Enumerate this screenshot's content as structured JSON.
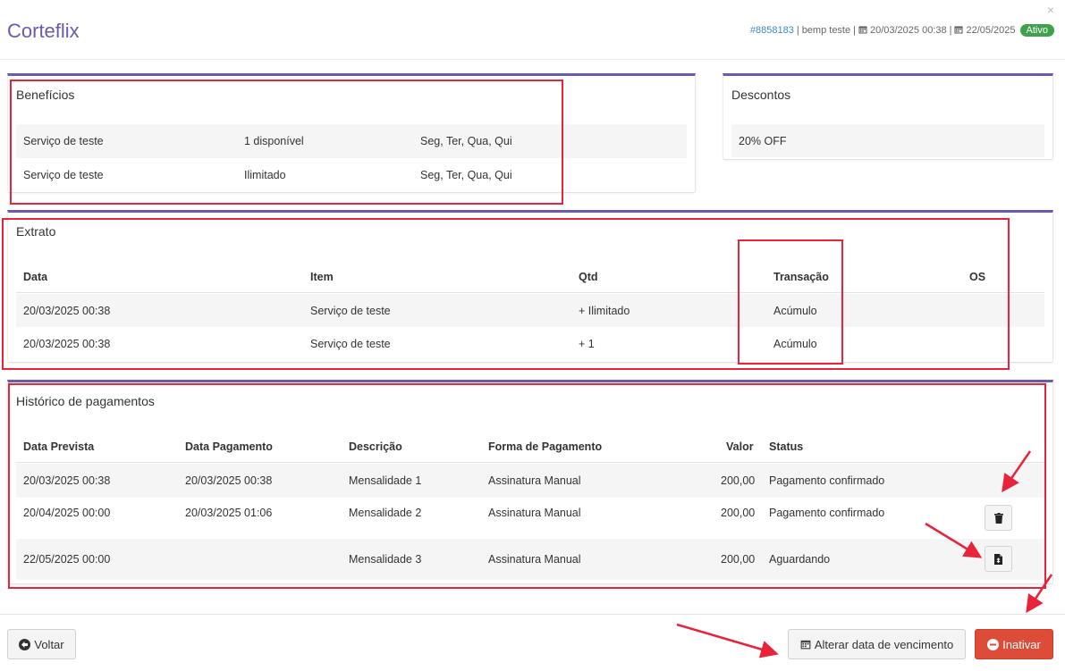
{
  "header": {
    "title": "Corteflix",
    "close": "×",
    "id": "#8858183",
    "sep1": "|",
    "customer": "bemp teste",
    "sep2": "|",
    "start_date": "20/03/2025 00:38",
    "sep3": "|",
    "end_date": "22/05/2025",
    "status": "Ativo"
  },
  "beneficios": {
    "title": "Benefícios",
    "rows": [
      {
        "servico": "Serviço de teste",
        "qtd": "1 disponível",
        "dias": "Seg, Ter, Qua, Qui"
      },
      {
        "servico": "Serviço de teste",
        "qtd": "Ilimitado",
        "dias": "Seg, Ter, Qua, Qui"
      }
    ]
  },
  "descontos": {
    "title": "Descontos",
    "rows": [
      {
        "valor": "20% OFF"
      }
    ]
  },
  "extrato": {
    "title": "Extrato",
    "columns": [
      "Data",
      "Item",
      "Qtd",
      "Transação",
      "OS"
    ],
    "rows": [
      {
        "data": "20/03/2025 00:38",
        "item": "Serviço de teste",
        "qtd": "+ Ilimitado",
        "transacao": "Acúmulo",
        "os": ""
      },
      {
        "data": "20/03/2025 00:38",
        "item": "Serviço de teste",
        "qtd": "+ 1",
        "transacao": "Acúmulo",
        "os": ""
      }
    ]
  },
  "historico": {
    "title": "Histórico de pagamentos",
    "columns": [
      "Data Prevista",
      "Data Pagamento",
      "Descrição",
      "Forma de Pagamento",
      "Valor",
      "Status"
    ],
    "rows": [
      {
        "prevista": "20/03/2025 00:38",
        "pagamento": "20/03/2025 00:38",
        "descricao": "Mensalidade 1",
        "forma": "Assinatura Manual",
        "valor": "200,00",
        "status": "Pagamento confirmado"
      },
      {
        "prevista": "20/04/2025 00:00",
        "pagamento": "20/03/2025 01:06",
        "descricao": "Mensalidade 2",
        "forma": "Assinatura Manual",
        "valor": "200,00",
        "status": "Pagamento confirmado"
      },
      {
        "prevista": "22/05/2025 00:00",
        "pagamento": "",
        "descricao": "Mensalidade 3",
        "forma": "Assinatura Manual",
        "valor": "200,00",
        "status": "Aguardando"
      }
    ]
  },
  "footer": {
    "voltar": "Voltar",
    "alterar": "Alterar data de vencimento",
    "inativar": "Inativar"
  },
  "colors": {
    "accent": "#6a5bb0",
    "link": "#3d8ec6",
    "success": "#3fa14b",
    "danger": "#dd4b39",
    "annotation": "#e8233a"
  },
  "icons": [
    "close-icon",
    "calendar-icon",
    "trash-icon",
    "invoice-icon",
    "arrow-left-circle-icon",
    "minus-circle-icon"
  ]
}
